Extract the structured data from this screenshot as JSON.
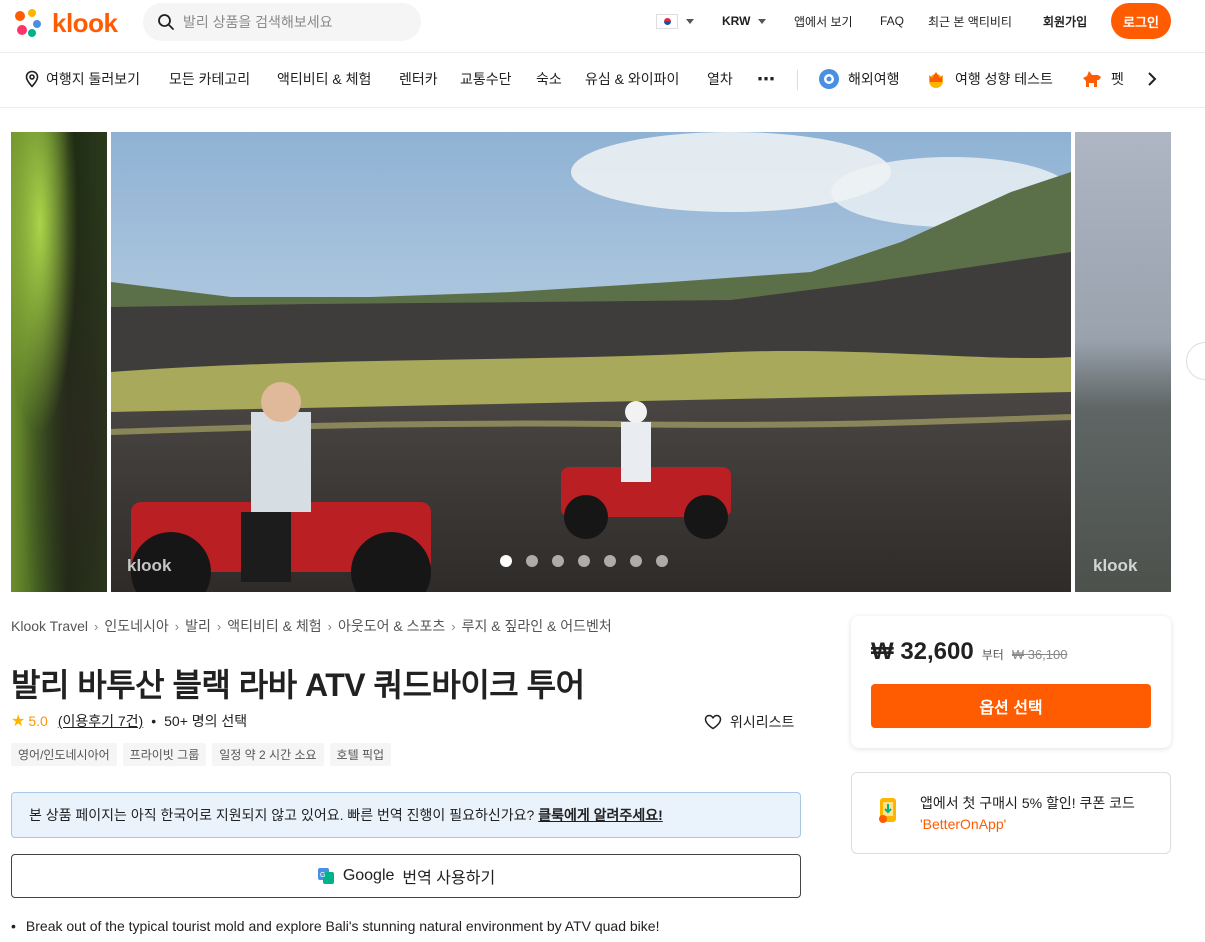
{
  "header": {
    "logo_text": "klook",
    "search_placeholder": "발리 상품을 검색해보세요",
    "currency": "KRW",
    "app_link": "앱에서 보기",
    "faq": "FAQ",
    "recent": "최근 본 액티비티",
    "signup": "회원가입",
    "login": "로그인"
  },
  "catnav": {
    "items": [
      {
        "label": "여행지 둘러보기",
        "icon": "location-pin-icon"
      },
      {
        "label": "모든 카테고리"
      },
      {
        "label": "액티비티 & 체험"
      },
      {
        "label": "렌터카"
      },
      {
        "label": "교통수단"
      },
      {
        "label": "숙소"
      },
      {
        "label": "유심 & 와이파이"
      },
      {
        "label": "열차"
      },
      {
        "label": "⋯"
      },
      {
        "label": "해외여행",
        "icon": "globe-icon"
      },
      {
        "label": "여행 성향 테스트",
        "icon": "crown-icon"
      },
      {
        "label": "펫",
        "icon": "dog-icon"
      }
    ]
  },
  "gallery": {
    "watermark": "klook",
    "slide_count": 7,
    "active_slide": 1
  },
  "breadcrumb": [
    "Klook Travel",
    "인도네시아",
    "발리",
    "액티비티 & 체험",
    "아웃도어 & 스포츠",
    "루지 & 짚라인 & 어드벤처"
  ],
  "product": {
    "title": "발리 바투산 블랙 라바 ATV 쿼드바이크 투어",
    "rating": "5.0",
    "reviews": "(이용후기 7건)",
    "booked": "50+ 명의 선택",
    "wishlist": "위시리스트",
    "tags": [
      "영어/인도네시아어",
      "프라이빗 그룹",
      "일정 약 2 시간 소요",
      "호텔 픽업"
    ],
    "notice_text": "본 상품 페이지는 아직 한국어로 지원되지 않고 있어요. 빠른 번역 진행이 필요하신가요?",
    "notice_link": "클룩에게 알려주세요!",
    "translate_google": "Google",
    "translate_label": "번역 사용하기",
    "bullet": "Break out of the typical tourist mold and explore Bali's stunning natural environment by ATV quad bike!"
  },
  "booking": {
    "price": "₩ 32,600",
    "from": "부터",
    "old_price": "₩ 36,100",
    "option_button": "옵션 선택",
    "app_promo": "앱에서 첫 구매시 5% 할인! 쿠폰 코드",
    "coupon": "'BetterOnApp'"
  },
  "colors": {
    "brand": "#ff5b00",
    "notice_bg": "#eaf3fc",
    "star": "#ffb400"
  }
}
